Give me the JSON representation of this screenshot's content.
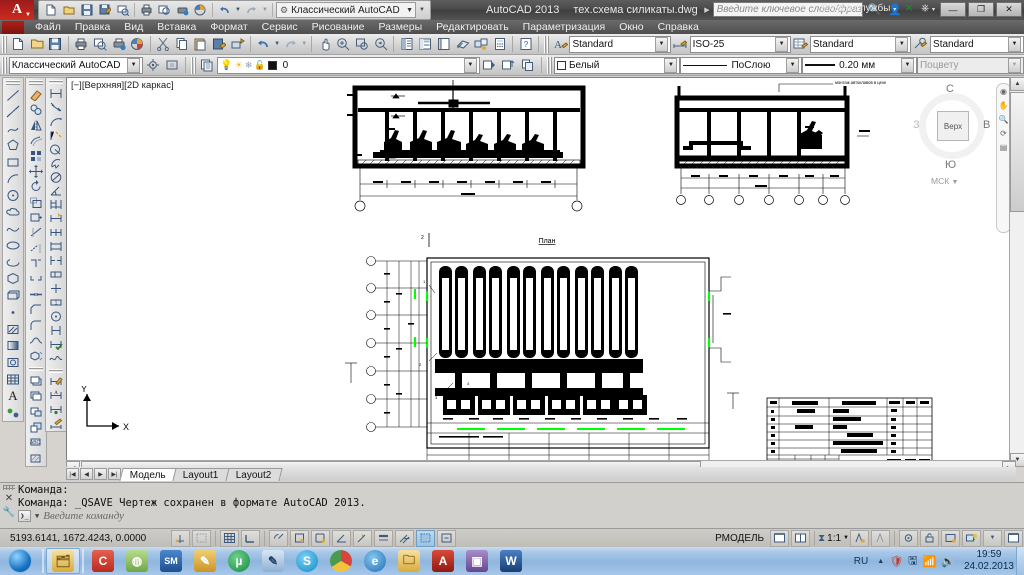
{
  "titlebar": {
    "workspace": "Классический AutoCAD",
    "app_name": "AutoCAD 2013",
    "file_name": "тех.схема силикаты.dwg",
    "search_placeholder": "Введите ключевое слово/фразу",
    "signin_label": "Вход в службы",
    "qat_icons": [
      "new-icon",
      "open-icon",
      "save-icon",
      "saveas-icon",
      "plot-icon",
      "undo-icon",
      "redo-icon"
    ],
    "window_buttons": [
      "minimize",
      "restore",
      "close"
    ]
  },
  "menubar": {
    "items": [
      {
        "label": "Файл"
      },
      {
        "label": "Правка"
      },
      {
        "label": "Вид"
      },
      {
        "label": "Вставка"
      },
      {
        "label": "Формат"
      },
      {
        "label": "Сервис"
      },
      {
        "label": "Рисование"
      },
      {
        "label": "Размеры"
      },
      {
        "label": "Редактировать"
      },
      {
        "label": "Параметризация"
      },
      {
        "label": "Окно"
      },
      {
        "label": "Справка"
      }
    ]
  },
  "toolbars": {
    "standard": {
      "text_style": "Standard",
      "dim_style": "ISO-25",
      "table_style": "Standard",
      "mleader_style": "Standard"
    },
    "layers": {
      "workspace": "Классический AutoCAD",
      "current_layer": "0"
    },
    "properties": {
      "color": "Белый",
      "linetype": "ПоСлою",
      "lineweight": "0.20 мм",
      "plotstyle": "Поцвету"
    }
  },
  "viewport": {
    "label": "[−][Верхняя][2D каркас]",
    "viewcube": {
      "top": "Верх",
      "north": "С",
      "south": "Ю",
      "west": "З",
      "east": "В",
      "ucs": "МСК"
    },
    "ucs_axes": {
      "x": "X",
      "y": "Y"
    },
    "drawing": {
      "plan_title": "План",
      "note_right": "монтаж автоклавов в цехе"
    }
  },
  "layout_tabs": {
    "nav": [
      "first",
      "prev",
      "next",
      "last"
    ],
    "tabs": [
      {
        "label": "Модель",
        "active": true
      },
      {
        "label": "Layout1",
        "active": false
      },
      {
        "label": "Layout2",
        "active": false
      }
    ]
  },
  "command_line": {
    "history": [
      "Команда:",
      "Команда: _QSAVE Чертеж сохранен в формате AutoCAD 2013."
    ],
    "placeholder": "Введите команду",
    "prompt_glyph": "❯_"
  },
  "statusbar": {
    "coordinates": "5193.6141, 1672.4243, 0.0000",
    "space_label": "РМОДЕЛЬ",
    "annotation_scale": "1:1",
    "toggles": [
      {
        "name": "snap",
        "on": false
      },
      {
        "name": "grid",
        "on": false
      },
      {
        "name": "ortho",
        "on": false
      },
      {
        "name": "polar",
        "on": false
      },
      {
        "name": "osnap",
        "on": false
      },
      {
        "name": "otrack",
        "on": false
      },
      {
        "name": "ducs",
        "on": false
      },
      {
        "name": "dyn",
        "on": false
      },
      {
        "name": "lwt",
        "on": true
      },
      {
        "name": "transparency",
        "on": false
      },
      {
        "name": "qp",
        "on": false
      },
      {
        "name": "sc",
        "on": false
      }
    ]
  },
  "taskbar": {
    "apps": [
      {
        "name": "explorer-icon",
        "glyph": "🗂",
        "color": "#e8c46a"
      },
      {
        "name": "ccleaner-icon",
        "glyph": "C",
        "color": "#d43b28"
      },
      {
        "name": "installer-icon",
        "glyph": "◍",
        "color": "#8ab95e"
      },
      {
        "name": "sm-icon",
        "glyph": "SM",
        "color": "#2a5fa8"
      },
      {
        "name": "tweak-icon",
        "glyph": "✎",
        "color": "#d6a436"
      },
      {
        "name": "utorrent-icon",
        "glyph": "µ",
        "color": "#1f9e4a"
      },
      {
        "name": "paint-icon",
        "glyph": "✎",
        "color": "#3b6fae"
      },
      {
        "name": "skype-icon",
        "glyph": "S",
        "color": "#2ca5e0"
      },
      {
        "name": "chrome-icon",
        "glyph": "◉",
        "color": "#d9453a"
      },
      {
        "name": "ie-icon",
        "glyph": "e",
        "color": "#2d7fc1"
      },
      {
        "name": "folder2-icon",
        "glyph": "🗀",
        "color": "#e0b44e"
      },
      {
        "name": "autocad-icon",
        "glyph": "A",
        "color": "#b1231a"
      },
      {
        "name": "media-icon",
        "glyph": "▣",
        "color": "#7a5a9e"
      },
      {
        "name": "word-icon",
        "glyph": "W",
        "color": "#1d4f91"
      }
    ],
    "tray": {
      "language": "RU",
      "icons": [
        "show-hidden-icon",
        "antivirus-icon",
        "device-icon",
        "network-icon",
        "volume-icon"
      ],
      "time": "19:59",
      "date": "24.02.2013"
    }
  }
}
